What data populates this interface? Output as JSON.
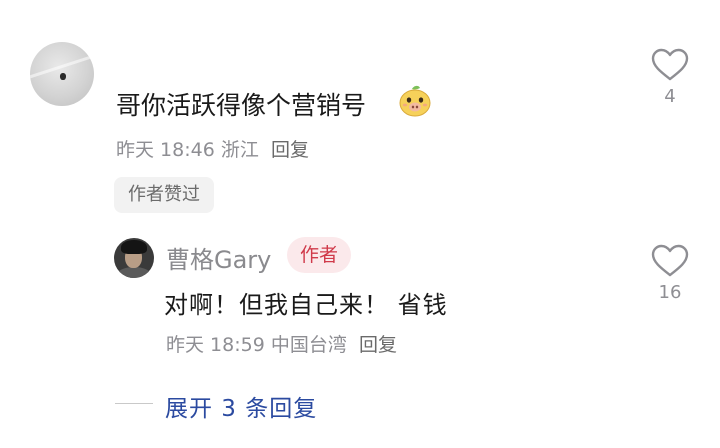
{
  "comment": {
    "text": "哥你活跃得像个营销号",
    "emoji_icon": "pig-face-emoji",
    "time": "昨天 18:46",
    "location": "浙江",
    "reply_label": "回复",
    "liked_badge": "作者赞过",
    "like_count": "4"
  },
  "reply": {
    "username": "曹格Gary",
    "author_badge": "作者",
    "text": "对啊！但我自己来！ 省钱",
    "time": "昨天 18:59",
    "location": "中国台湾",
    "reply_label": "回复",
    "like_count": "16"
  },
  "expand_replies": {
    "label": "展开 3 条回复"
  },
  "colors": {
    "link_blue": "#2b4aa0",
    "author_badge_bg": "#fbe9eb",
    "author_badge_text": "#d03a4a",
    "meta_gray": "#8e8e93"
  }
}
